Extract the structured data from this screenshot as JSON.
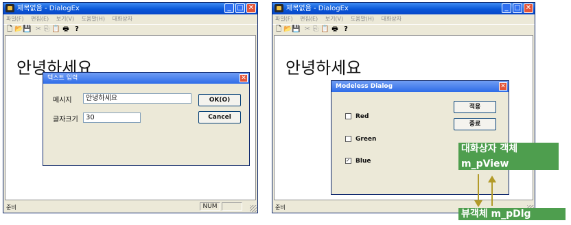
{
  "left_window": {
    "title": "제목없음 - DialogEx",
    "menu": [
      "파일(F)",
      "편집(E)",
      "보기(V)",
      "도움말(H)",
      "대화상자"
    ],
    "content_text": "안녕하세요",
    "status_ready": "준비",
    "status_num": "NUM",
    "dialog": {
      "title": "텍스트 입력",
      "message_label": "메시지",
      "message_value": "안녕하세요",
      "size_label": "글자크기",
      "size_value": "30",
      "ok_label": "OK(O)",
      "cancel_label": "Cancel"
    }
  },
  "right_window": {
    "title": "제목없음 - DialogEx",
    "menu": [
      "파일(F)",
      "편집(E)",
      "보기(V)",
      "도움말(H)",
      "대화상자"
    ],
    "content_text": "안녕하세요",
    "status_ready": "준비",
    "dialog": {
      "title": "Modeless Dialog",
      "apply_label": "적용",
      "close_label": "종료",
      "options": [
        {
          "label": "Red",
          "checked": false
        },
        {
          "label": "Green",
          "checked": false
        },
        {
          "label": "Blue",
          "checked": true
        }
      ]
    }
  },
  "annotations": {
    "dialog_object_line1": "대화상자 객체",
    "dialog_object_line2": "m_pView",
    "view_object": "뷰객체 m_pDlg"
  },
  "colors": {
    "annotation_bg": "#4e9e4e",
    "arrow": "#b29a28",
    "titlebar": "#0a57d8"
  }
}
